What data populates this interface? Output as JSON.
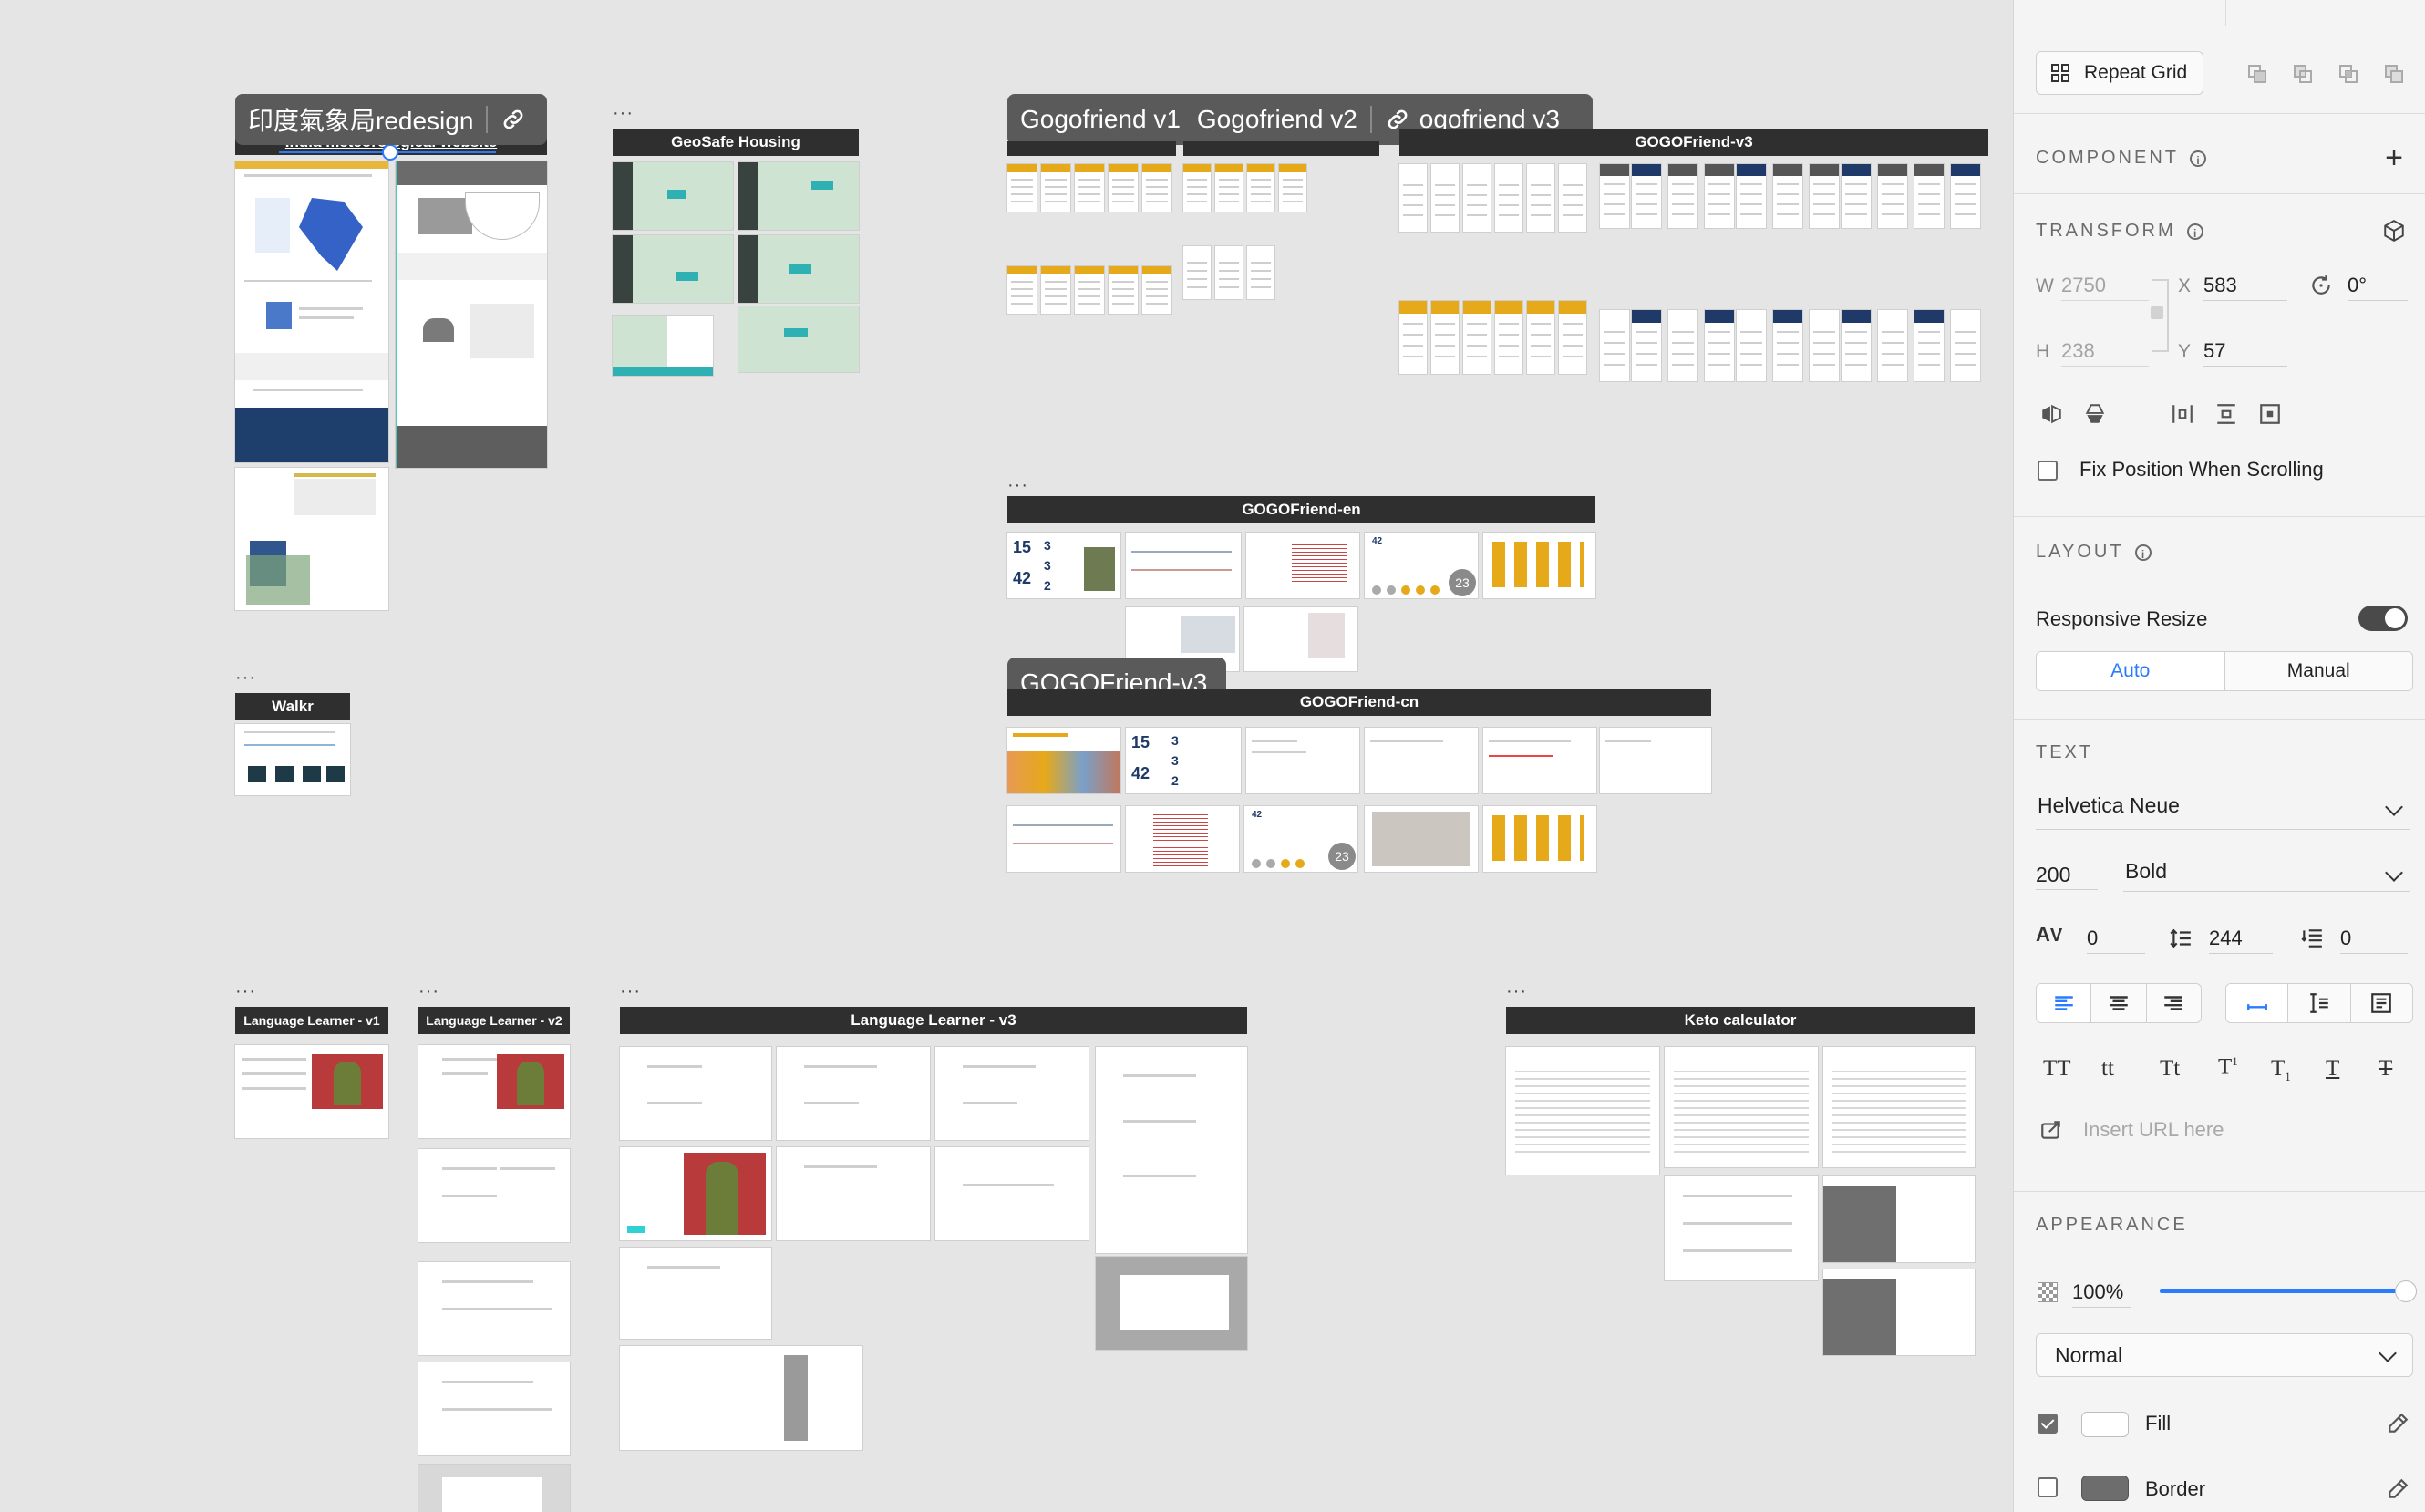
{
  "canvas": {
    "artboards": {
      "imd": "India meteorological website",
      "geosafe": "GeoSafe Housing",
      "gogo_v1": "GOGOfriend-v1",
      "gogo_v2": "GOGOfriend-v2",
      "gogo_v3": "GOGOFriend-v3",
      "gogo_en": "GOGOFriend-en",
      "gogo_cn": "GOGOFriend-cn",
      "walkr": "Walkr",
      "ll_v1": "Language Learner - v1",
      "ll_v2": "Language Learner - v2",
      "ll_v3": "Language Learner - v3",
      "keto": "Keto calculator"
    },
    "link_pills": {
      "imd": {
        "label": "印度氣象局redesign"
      },
      "gogo": {
        "label1": "Gogofriend v1",
        "label2": "Gogofriend v2",
        "label3": "ogofriend v3"
      },
      "gogo_cn": {
        "label": "GOGOFriend-v3"
      }
    },
    "thumb_numbers": {
      "en_a": "15",
      "en_b": "42",
      "en_c": "3",
      "en_d": "3",
      "en_e": "2",
      "en_badge": "23",
      "en_f": "42",
      "cn_a": "15",
      "cn_b": "42",
      "cn_c": "3",
      "cn_d": "3",
      "cn_e": "2",
      "cn_badge": "23",
      "cn_f": "42"
    }
  },
  "panel": {
    "repeat_grid": "Repeat Grid",
    "component": {
      "title": "COMPONENT",
      "add_icon": "plus-icon"
    },
    "transform": {
      "title": "TRANSFORM",
      "w_label": "W",
      "w_value": "2750",
      "h_label": "H",
      "h_value": "238",
      "x_label": "X",
      "x_value": "583",
      "y_label": "Y",
      "y_value": "57",
      "rotation": "0°",
      "fix_position": "Fix Position When Scrolling"
    },
    "layout": {
      "title": "LAYOUT",
      "responsive_resize": "Responsive Resize",
      "responsive_on": true,
      "auto": "Auto",
      "manual": "Manual"
    },
    "text": {
      "title": "TEXT",
      "font": "Helvetica Neue",
      "size": "200",
      "weight": "Bold",
      "char_spacing": "0",
      "line_spacing": "244",
      "para_spacing": "0",
      "transforms": [
        "TT",
        "tt",
        "Tt"
      ],
      "url_placeholder": "Insert URL here"
    },
    "appearance": {
      "title": "APPEARANCE",
      "opacity": "100%",
      "blend": "Normal",
      "fill_label": "Fill",
      "fill_checked": true,
      "fill_color": "#ffffff",
      "border_label": "Border",
      "border_checked": false,
      "border_color": "#6d6d6d"
    }
  },
  "colors": {
    "accent_blue": "#2b7bff",
    "gogo_yellow": "#e6a91a",
    "navy": "#1f3a68",
    "artboard_title_bg": "#2f2f2f"
  }
}
